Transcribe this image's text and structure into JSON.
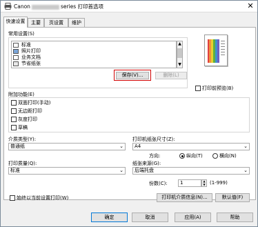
{
  "window": {
    "title_prefix": "Canon",
    "title_suffix": "series 打印首选项",
    "close_glyph": "✕"
  },
  "tabs": [
    {
      "label": "快速设置",
      "active": true
    },
    {
      "label": "主要"
    },
    {
      "label": "页设置"
    },
    {
      "label": "维护"
    }
  ],
  "common_settings": {
    "label": "常用设置(S)",
    "items": [
      "标准",
      "照片打印",
      "业务文档",
      "节省纸张"
    ],
    "save_button": "保存(V)...",
    "delete_button": "删除(L)"
  },
  "preview_checkbox": "打印前预览(B)",
  "additional_features": {
    "label": "附加功能(E)",
    "options": [
      "双面打印(手动)",
      "无边距打印",
      "灰度打印",
      "草稿"
    ]
  },
  "media_type": {
    "label": "介质类型(Y):",
    "value": "普通纸"
  },
  "printer_paper_size": {
    "label": "打印机纸张尺寸(Z):",
    "value": "A4"
  },
  "orientation": {
    "label": "方向:",
    "portrait": "纵向(T)",
    "landscape": "横向(N)"
  },
  "print_quality": {
    "label": "打印质量(Q):",
    "value": "标准"
  },
  "paper_source": {
    "label": "纸张来源(G):",
    "value": "后端托盘"
  },
  "copies": {
    "label": "份数(C):",
    "value": "1",
    "range": "(1-999)"
  },
  "always_print_current": "始终以当前设置打印(W)",
  "media_info_button": "打印机介质信息(N)...",
  "defaults_button": "默认值(F)",
  "footer": {
    "ok": "确定",
    "cancel": "取消",
    "apply": "应用(A)",
    "help": "帮助"
  }
}
